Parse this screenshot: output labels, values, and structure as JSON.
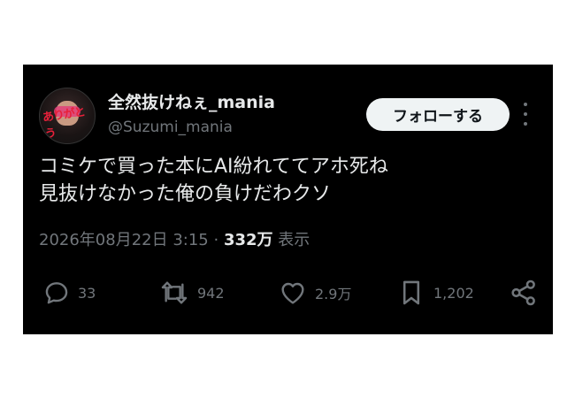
{
  "tweet": {
    "author": {
      "display_name": "全然抜けねぇ_mania",
      "handle": "@Suzumi_mania",
      "avatar_scribble": "ありがとう"
    },
    "follow_label": "フォローする",
    "text_lines": [
      "コミケで買った本にAI紛れててアホ死ね",
      "見抜けなかった俺の負けだわクソ"
    ],
    "timestamp": "2026年08月22日 3:15",
    "separator": " · ",
    "views": "332万",
    "views_label": " 表示",
    "actions": {
      "replies": "33",
      "reposts": "942",
      "likes": "2.9万",
      "bookmarks": "1,202"
    }
  },
  "colors": {
    "card_background": "#000000",
    "page_background": "#ffffff",
    "primary_text": "#e7e9ea",
    "secondary_text": "#71767b",
    "follow_button_bg": "#eff3f4"
  },
  "icons": {
    "reply": "speech-bubble-icon",
    "repost": "repost-arrows-icon",
    "like": "heart-icon",
    "bookmark": "bookmark-icon",
    "share": "share-icon",
    "more": "more-dots-icon"
  }
}
